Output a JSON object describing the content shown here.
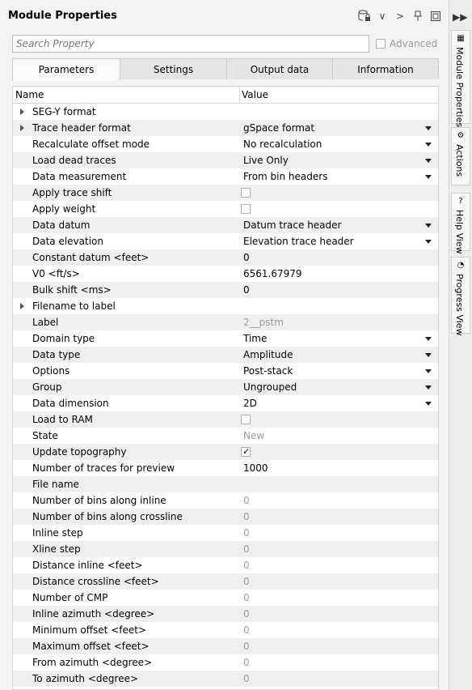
{
  "panel": {
    "title": "Module Properties",
    "toolbar_icons": [
      "database-lock-icon",
      "chevron-down-icon",
      "chevron-right-icon",
      "pin-icon",
      "float-icon"
    ]
  },
  "search": {
    "placeholder": "Search Property"
  },
  "advanced": {
    "label": "Advanced",
    "checked": false
  },
  "tabs": [
    {
      "label": "Parameters",
      "active": true
    },
    {
      "label": "Settings",
      "active": false
    },
    {
      "label": "Output data",
      "active": false
    },
    {
      "label": "Information",
      "active": false
    }
  ],
  "grid": {
    "headers": {
      "name": "Name",
      "value": "Value"
    },
    "rows": [
      {
        "name": "SEG-Y format",
        "value": "",
        "expandable": true
      },
      {
        "name": "Trace header format",
        "value": "gSpace format",
        "expandable": true,
        "dropdown": true
      },
      {
        "name": "Recalculate offset mode",
        "value": "No recalculation",
        "dropdown": true
      },
      {
        "name": "Load dead traces",
        "value": "Live Only",
        "dropdown": true
      },
      {
        "name": "Data measurement",
        "value": "From bin headers",
        "dropdown": true
      },
      {
        "name": "Apply trace shift",
        "value": "",
        "checkbox": false
      },
      {
        "name": "Apply weight",
        "value": "",
        "checkbox": false
      },
      {
        "name": "Data datum",
        "value": "Datum trace header",
        "dropdown": true
      },
      {
        "name": "Data elevation",
        "value": "Elevation trace header",
        "dropdown": true
      },
      {
        "name": "Constant datum <feet>",
        "value": "0"
      },
      {
        "name": "V0 <ft/s>",
        "value": "6561.67979"
      },
      {
        "name": "Bulk shift <ms>",
        "value": "0"
      },
      {
        "name": "Filename to label",
        "value": "",
        "expandable": true
      },
      {
        "name": "Label",
        "value": "2__pstm",
        "disabled": true
      },
      {
        "name": "Domain type",
        "value": "Time",
        "dropdown": true
      },
      {
        "name": "Data type",
        "value": "Amplitude",
        "dropdown": true
      },
      {
        "name": "Options",
        "value": "Post-stack",
        "dropdown": true
      },
      {
        "name": "Group",
        "value": "Ungrouped",
        "dropdown": true
      },
      {
        "name": "Data dimension",
        "value": "2D",
        "dropdown": true
      },
      {
        "name": "Load to RAM",
        "value": "",
        "checkbox": false
      },
      {
        "name": "State",
        "value": "New",
        "disabled": true
      },
      {
        "name": "Update topography",
        "value": "",
        "checkbox": true
      },
      {
        "name": "Number of traces for preview",
        "value": "1000"
      },
      {
        "name": "File name",
        "value": ""
      },
      {
        "name": "Number of bins along inline",
        "value": "0",
        "disabled": true
      },
      {
        "name": "Number of bins along crossline",
        "value": "0",
        "disabled": true
      },
      {
        "name": "Inline step",
        "value": "0",
        "disabled": true
      },
      {
        "name": "Xline step",
        "value": "0",
        "disabled": true
      },
      {
        "name": "Distance inline <feet>",
        "value": "0",
        "disabled": true
      },
      {
        "name": "Distance crossline <feet>",
        "value": "0",
        "disabled": true
      },
      {
        "name": "Number of CMP",
        "value": "0",
        "disabled": true
      },
      {
        "name": "Inline azimuth <degree>",
        "value": "0",
        "disabled": true
      },
      {
        "name": "Minimum offset <feet>",
        "value": "0",
        "disabled": true
      },
      {
        "name": "Maximum offset <feet>",
        "value": "0",
        "disabled": true
      },
      {
        "name": "From azimuth <degree>",
        "value": "0",
        "disabled": true
      },
      {
        "name": "To azimuth <degree>",
        "value": "0",
        "disabled": true
      }
    ]
  },
  "side_tabs": [
    {
      "label": "Module Properties",
      "icon": "module-properties-icon"
    },
    {
      "label": "Actions",
      "icon": "actions-icon"
    },
    {
      "label": "Help View",
      "icon": "help-icon"
    },
    {
      "label": "Progress View",
      "icon": "progress-icon"
    }
  ]
}
